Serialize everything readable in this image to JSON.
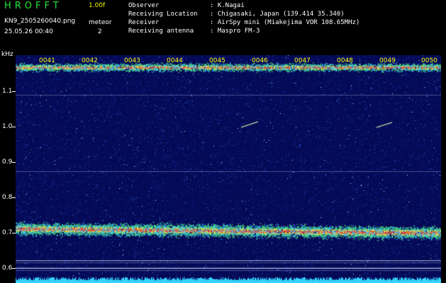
{
  "header": {
    "app_name": "HROFFT",
    "version": "1.00f",
    "filename": "KN9_2505260040.png",
    "meteor_label": "meteor",
    "meteor_count": "2",
    "datetime": "25.05.26 00:40"
  },
  "info": [
    {
      "label": "Observer",
      "value": ": K.Nagai"
    },
    {
      "label": "Receiving Location",
      "value": ": Chigasaki, Japan (139.414 35.340)"
    },
    {
      "label": "Receiver",
      "value": ": AirSpy mini (Miakejima VOR 108.65MHz)"
    },
    {
      "label": "Receiving antenna",
      "value": ": Maspro FM-3"
    }
  ],
  "axis": {
    "unit": "kHz",
    "y_ticks": [
      "1.1",
      "1.0",
      "0.9",
      "0.8",
      "0.7",
      "0.6"
    ],
    "x_ticks": [
      "0041",
      "0042",
      "0043",
      "0044",
      "0045",
      "0046",
      "0047",
      "0048",
      "0049",
      "0050"
    ]
  },
  "colors": {
    "app_name": "#27e63a",
    "version": "#f7f700",
    "tick_labels": "#ffff00",
    "background": "#040a55"
  }
}
